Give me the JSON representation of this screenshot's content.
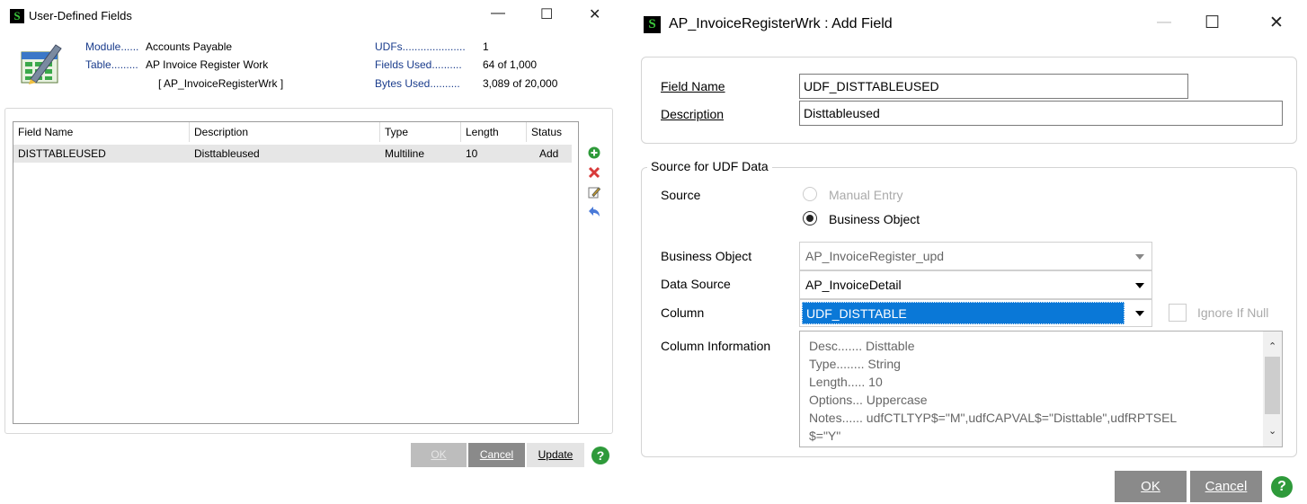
{
  "left_window": {
    "title": "User-Defined Fields",
    "controls": [
      "—",
      "☐",
      "✕"
    ],
    "info": {
      "module_label": "Module......",
      "module_value": "Accounts Payable",
      "table_label": "Table.........",
      "table_value": "AP Invoice Register Work",
      "table_code": "[ AP_InvoiceRegisterWrk ]",
      "udfs_label": "UDFs.....................",
      "udfs_value": "1",
      "fields_used_label": "Fields Used..........",
      "fields_used_value": "64 of 1,000",
      "bytes_used_label": "Bytes Used..........",
      "bytes_used_value": "3,089 of 20,000"
    },
    "grid": {
      "columns": [
        "Field Name",
        "Description",
        "Type",
        "Length",
        "Status"
      ],
      "rows": [
        [
          "DISTTABLEUSED",
          "Disttableused",
          "Multiline",
          "10",
          "Add"
        ]
      ]
    },
    "buttons": {
      "ok": "OK",
      "cancel": "Cancel",
      "update": "Update",
      "help": "?"
    }
  },
  "right_window": {
    "title": "AP_InvoiceRegisterWrk : Add Field",
    "controls": [
      "—",
      "☐",
      "✕"
    ],
    "field_name_label": "Field Name",
    "field_name_value": "UDF_DISTTABLEUSED",
    "description_label": "Description",
    "description_value": "Disttableused",
    "source_group_title": "Source for UDF Data",
    "source_label": "Source",
    "manual_entry": "Manual Entry",
    "business_object_option": "Business Object",
    "business_object_label": "Business Object",
    "business_object_value": "AP_InvoiceRegister_upd",
    "data_source_label": "Data Source",
    "data_source_value": "AP_InvoiceDetail",
    "column_label": "Column",
    "column_value": "UDF_DISTTABLE",
    "ignore_if_null": "Ignore If Null",
    "column_info_label": "Column Information",
    "column_info_lines": [
      "Desc.......  Disttable",
      "Type........  String",
      "Length.....  10",
      "Options...  Uppercase",
      "Notes......  udfCTLTYP$=\"M\",udfCAPVAL$=\"Disttable\",udfRPTSEL",
      "$=\"Y\""
    ],
    "buttons": {
      "ok": "OK",
      "cancel": "Cancel",
      "help": "?"
    }
  }
}
